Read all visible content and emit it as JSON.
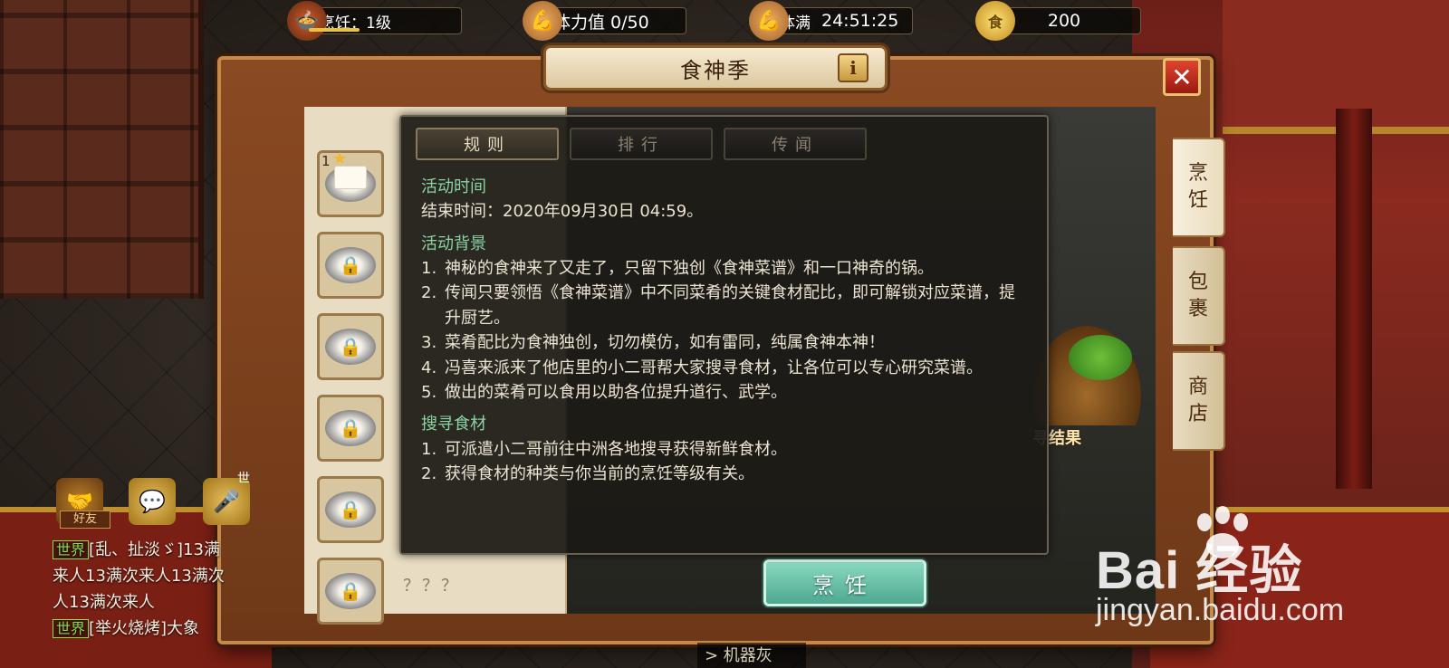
{
  "status_bar": {
    "cooking_label": "烹饪：1级",
    "cooking_progress": 0.35,
    "stamina_label": "体力值 0/50",
    "full_label": "体满",
    "full_timer": "24:51:25",
    "gold_icon_char": "食",
    "gold_value": "200"
  },
  "panel": {
    "title": "食神季",
    "info_label": "i",
    "close_label": "✕",
    "side_tabs": [
      {
        "label_1": "烹",
        "label_2": "饪"
      },
      {
        "label_1": "包",
        "label_2": "裹"
      },
      {
        "label_1": "商",
        "label_2": "店"
      }
    ]
  },
  "recipes": {
    "first_slot_count": "1",
    "unknown_label": "？？？"
  },
  "kitchen": {
    "search_result_label": "寻结果",
    "cook_button": "烹饪"
  },
  "overlay": {
    "tabs": [
      "规则",
      "排行",
      "传闻"
    ],
    "active_tab": "规则",
    "sections": [
      {
        "title": "活动时间",
        "lines": [
          {
            "n": "",
            "text": "结束时间：2020年09月30日 04:59。"
          }
        ]
      },
      {
        "title": "活动背景",
        "lines": [
          {
            "n": "1.",
            "text": "神秘的食神来了又走了，只留下独创《食神菜谱》和一口神奇的锅。"
          },
          {
            "n": "2.",
            "text": "传闻只要领悟《食神菜谱》中不同菜肴的关键食材配比，即可解锁对应菜谱，提升厨艺。"
          },
          {
            "n": "3.",
            "text": "菜肴配比为食神独创，切勿模仿，如有雷同，纯属食神本神！"
          },
          {
            "n": "4.",
            "text": "冯喜来派来了他店里的小二哥帮大家搜寻食材，让各位可以专心研究菜谱。"
          },
          {
            "n": "5.",
            "text": "做出的菜肴可以食用以助各位提升道行、武学。"
          }
        ]
      },
      {
        "title": "搜寻食材",
        "lines": [
          {
            "n": "1.",
            "text": "可派遣小二哥前往中洲各地搜寻获得新鲜食材。"
          },
          {
            "n": "2.",
            "text": "获得食材的种类与你当前的烹饪等级有关。"
          }
        ]
      }
    ]
  },
  "social": {
    "friends_label": "好友",
    "voice_tag": "世"
  },
  "chat": {
    "messages": [
      {
        "channel": "世界",
        "text": "[乱、扯淡ゞ]13满"
      },
      {
        "channel": "",
        "text": "来人13满次来人13满次"
      },
      {
        "channel": "",
        "text": "人13满次来人"
      },
      {
        "channel": "世界",
        "text": "[举火烧烤]大象"
      }
    ]
  },
  "bottom_strip": "> 机器灰",
  "watermark": {
    "main": "Bai 经验",
    "sub": "jingyan.baidu.com"
  },
  "colors": {
    "section_title": "#8ad4a2",
    "cook_button": "#6ec4aa",
    "chat_channel": "#8adc4a"
  }
}
